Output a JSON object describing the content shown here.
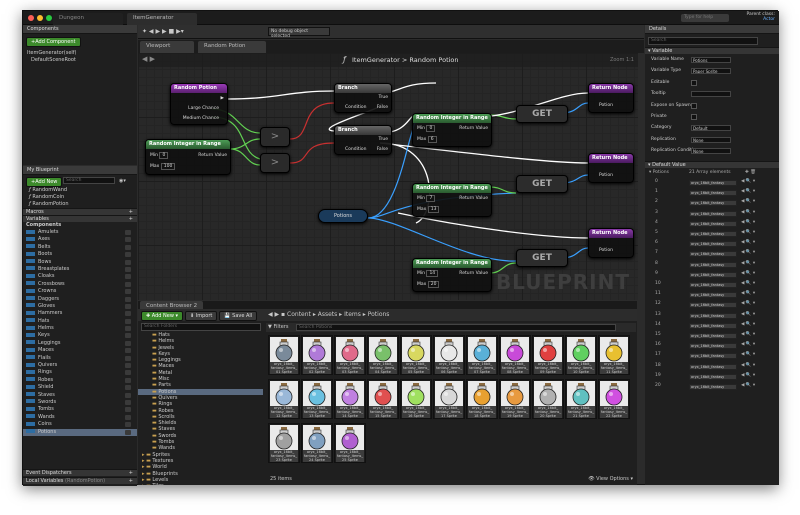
{
  "window": {
    "tabs": [
      "Dungeon",
      "ItemGenerator"
    ],
    "help_placeholder": "Type for help",
    "project": "Parent class:",
    "actor": "Actor"
  },
  "colors": {
    "event": "#8a3aa8",
    "func": "#4c8c55",
    "branch": "#5a5a5a",
    "ret": "#7a3aa0",
    "pin_green": "#62d252",
    "pin_blue": "#3aa0ff",
    "pin_cyan": "#9ed7e8"
  },
  "components": {
    "header": "Components",
    "add_button": "+Add Component",
    "items": [
      "ItemGenerator(self)",
      "DefaultSceneRoot"
    ]
  },
  "toolbar": {
    "debug_filter": "No debug object selected"
  },
  "myblueprint": {
    "header": "My Blueprint",
    "add_new": "+Add New",
    "search_placeholder": "Search",
    "functions": [
      "RandomWand",
      "RandomCoin",
      "RandomPotion"
    ],
    "macros_label": "Macros",
    "variables_label": "Variables",
    "components_label": "Components",
    "variables": [
      "Amulets",
      "Axes",
      "Belts",
      "Boots",
      "Bows",
      "Breastplates",
      "Cloaks",
      "Crossbows",
      "Crowns",
      "Daggers",
      "Gloves",
      "Hammers",
      "Hats",
      "Helms",
      "Keys",
      "Leggings",
      "Maces",
      "Flails",
      "Quivers",
      "Rings",
      "Robes",
      "Shield",
      "Staves",
      "Swords",
      "Tombs",
      "Wands",
      "Coins",
      "Potions"
    ],
    "event_dispatchers": "Event Dispatchers",
    "local_variables": "Local Variables",
    "local_variables_hint": "(RandomPotion)"
  },
  "graph": {
    "tabs": [
      "Viewport",
      "Random Potion"
    ],
    "breadcrumb_root": "ItemGenerator",
    "breadcrumb_sep": ">",
    "breadcrumb_leaf": "Random Potion",
    "zoom": "Zoom 1:1",
    "watermark": "BLUEPRINT",
    "nodes": {
      "random_potion": {
        "title": "Random Potion",
        "pins": [
          "Large Chance",
          "Medium Chance"
        ]
      },
      "rir_left": {
        "title": "Random Integer in Range",
        "min_label": "Min",
        "min_val": "0",
        "max_label": "Max",
        "max_val": "100",
        "ret": "Return Value"
      },
      "branch1": {
        "title": "Branch",
        "cond": "Condition",
        "t": "True",
        "f": "False"
      },
      "branch2": {
        "title": "Branch",
        "cond": "Condition",
        "t": "True",
        "f": "False"
      },
      "rir1": {
        "title": "Random Integer in Range",
        "min_label": "Min",
        "min_val": "0",
        "max_label": "Max",
        "max_val": "6",
        "ret": "Return Value"
      },
      "rir2": {
        "title": "Random Integer in Range",
        "min_label": "Min",
        "min_val": "7",
        "max_label": "Max",
        "max_val": "13",
        "ret": "Return Value"
      },
      "rir3": {
        "title": "Random Integer in Range",
        "min_label": "Min",
        "min_val": "14",
        "max_label": "Max",
        "max_val": "20",
        "ret": "Return Value"
      },
      "get": "GET",
      "potions": "Potions",
      "ret_title": "Return Node",
      "ret_pin": "Potion"
    }
  },
  "content_browser": {
    "tab": "Content Browser 2",
    "add_new": "Add New",
    "import": "Import",
    "save_all": "Save All",
    "search_folders": "Search Folders",
    "path": [
      "Content",
      "Assets",
      "Items",
      "Potions"
    ],
    "filters": "Filters",
    "search_placeholder": "Search Potions",
    "folders": [
      "Hats",
      "Helms",
      "Jewels",
      "Keys",
      "Leggings",
      "Maces",
      "Metal",
      "Misc",
      "Parts",
      "Potions",
      "Quivers",
      "Rings",
      "Robes",
      "Scrolls",
      "Shields",
      "Staves",
      "Swords",
      "Tombs",
      "Wands"
    ],
    "folders2": [
      "Sprites",
      "Textures",
      "World",
      "Blueprints",
      "Levels",
      "Tiles"
    ],
    "items_count": "25 items",
    "view_options": "View Options",
    "thumbs": [
      "oryx_16bit_ fantasy_items_ 01 Sprite",
      "oryx_16bit_ fantasy_items_ 02 Sprite",
      "oryx_16bit_ fantasy_items_ 03 Sprite",
      "oryx_16bit_ fantasy_items_ 04 Sprite",
      "oryx_16bit_ fantasy_items_ 05 Sprite",
      "oryx_16bit_ fantasy_items_ 06 Sprite",
      "oryx_16bit_ fantasy_items_ 07 Sprite",
      "oryx_16bit_ fantasy_items_ 08 Sprite",
      "oryx_16bit_ fantasy_items_ 09 Sprite",
      "oryx_16bit_ fantasy_items_ 10 Sprite",
      "oryx_16bit_ fantasy_items_ 11 Sprite",
      "oryx_16bit_ fantasy_items_ 12 Sprite",
      "oryx_16bit_ fantasy_items_ 13 Sprite",
      "oryx_16bit_ fantasy_items_ 14 Sprite",
      "oryx_16bit_ fantasy_items_ 15 Sprite",
      "oryx_16bit_ fantasy_items_ 16 Sprite",
      "oryx_16bit_ fantasy_items_ 17 Sprite",
      "oryx_16bit_ fantasy_items_ 18 Sprite",
      "oryx_16bit_ fantasy_items_ 19 Sprite",
      "oryx_16bit_ fantasy_items_ 20 Sprite",
      "oryx_16bit_ fantasy_items_ 21 Sprite",
      "oryx_16bit_ fantasy_items_ 22 Sprite",
      "oryx_16bit_ fantasy_items_ 23 Sprite",
      "oryx_16bit_ fantasy_items_ 24 Sprite",
      "oryx_16bit_ fantasy_items_ 25 Sprite"
    ],
    "potion_colors": [
      "#7a8a9a",
      "#b07ad8",
      "#e06a8a",
      "#79c06a",
      "#d8d860",
      "#e8e8e8",
      "#5ab0d8",
      "#c84ad8",
      "#e04040",
      "#60d060",
      "#e8c030",
      "#9ab8d8",
      "#6ac0e0",
      "#c080e0",
      "#e05050",
      "#a0e060",
      "#d8d8d8",
      "#e8a030",
      "#e89a40",
      "#b0b0b0",
      "#60c0c0",
      "#d050e0",
      "#a0a0a0",
      "#80a0c0",
      "#b060d0"
    ]
  },
  "details": {
    "header": "Details",
    "search_placeholder": "Search",
    "variable_section": "Variable",
    "props": [
      {
        "label": "Variable Name",
        "value": "Potions"
      },
      {
        "label": "Variable Type",
        "value": "Paper Sprite"
      },
      {
        "label": "Editable",
        "value": ""
      },
      {
        "label": "Tooltip",
        "value": ""
      },
      {
        "label": "Expose on Spawn",
        "value": ""
      },
      {
        "label": "Private",
        "value": ""
      },
      {
        "label": "Category",
        "value": "Default"
      },
      {
        "label": "Replication",
        "value": "None"
      },
      {
        "label": "Replication Condition",
        "value": "None"
      }
    ],
    "default_section": "Default Value",
    "array_label": "Potions",
    "array_count": "21 Array elements",
    "array_indices": [
      "0",
      "1",
      "2",
      "3",
      "4",
      "5",
      "6",
      "7",
      "8",
      "9",
      "10",
      "11",
      "12",
      "13",
      "14",
      "15",
      "16",
      "17",
      "18",
      "19",
      "20"
    ],
    "array_value": "oryx_16bit_fantasy"
  }
}
